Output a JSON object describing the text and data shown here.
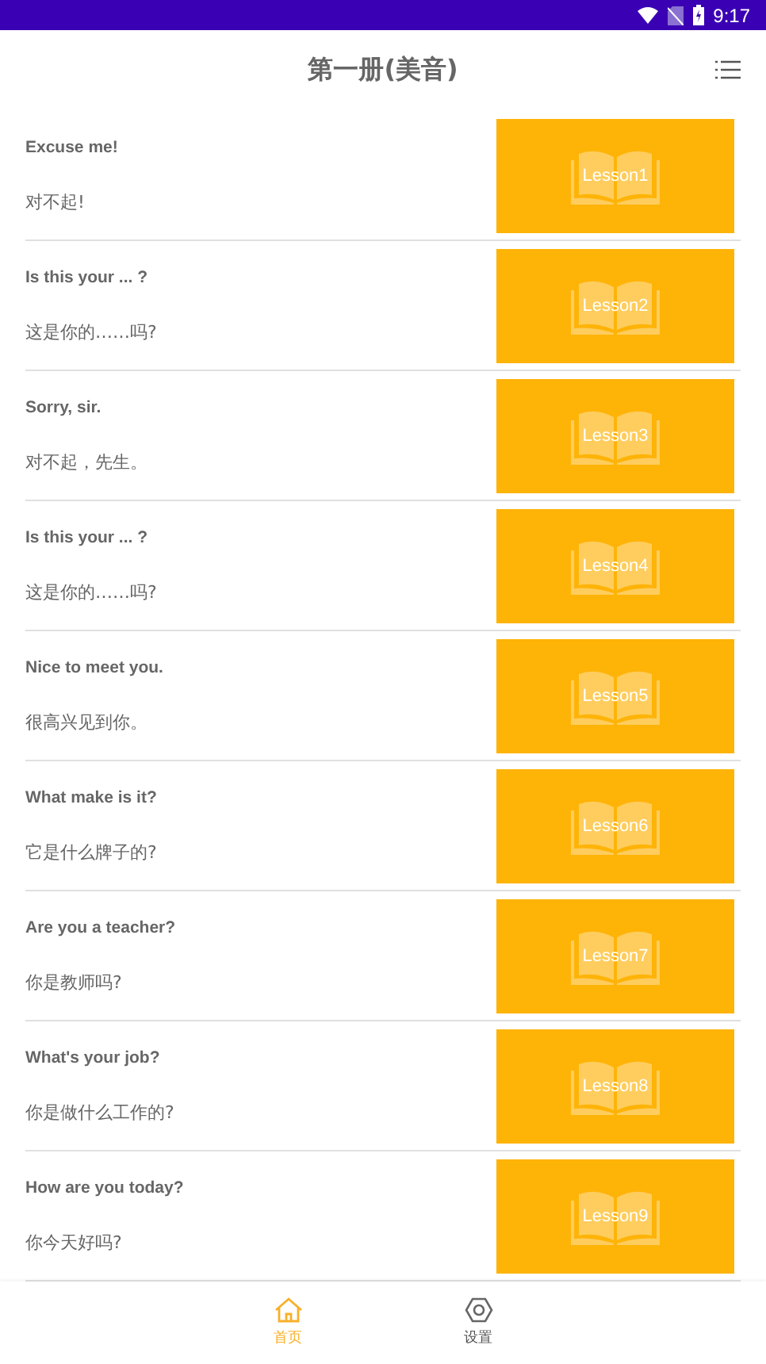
{
  "status_bar": {
    "time": "9:17"
  },
  "header": {
    "title": "第一册(美音)"
  },
  "lessons": [
    {
      "title": "Excuse me!",
      "translation": "对不起!",
      "cover_label": "Lesson1"
    },
    {
      "title": "Is this your ... ?",
      "translation": "这是你的……吗?",
      "cover_label": "Lesson2"
    },
    {
      "title": "Sorry, sir.",
      "translation": "对不起，先生。",
      "cover_label": "Lesson3"
    },
    {
      "title": "Is this your ... ?",
      "translation": "这是你的……吗?",
      "cover_label": "Lesson4"
    },
    {
      "title": "Nice to meet you.",
      "translation": "很高兴见到你。",
      "cover_label": "Lesson5"
    },
    {
      "title": "What make is it?",
      "translation": "它是什么牌子的?",
      "cover_label": "Lesson6"
    },
    {
      "title": "Are you a teacher?",
      "translation": "你是教师吗?",
      "cover_label": "Lesson7"
    },
    {
      "title": "What's your job?",
      "translation": "你是做什么工作的?",
      "cover_label": "Lesson8"
    },
    {
      "title": "How are you today?",
      "translation": "你今天好吗?",
      "cover_label": "Lesson9"
    }
  ],
  "bottom_nav": [
    {
      "label": "首页",
      "kind": "home",
      "selected": true
    },
    {
      "label": "设置",
      "kind": "settings",
      "selected": false
    }
  ]
}
